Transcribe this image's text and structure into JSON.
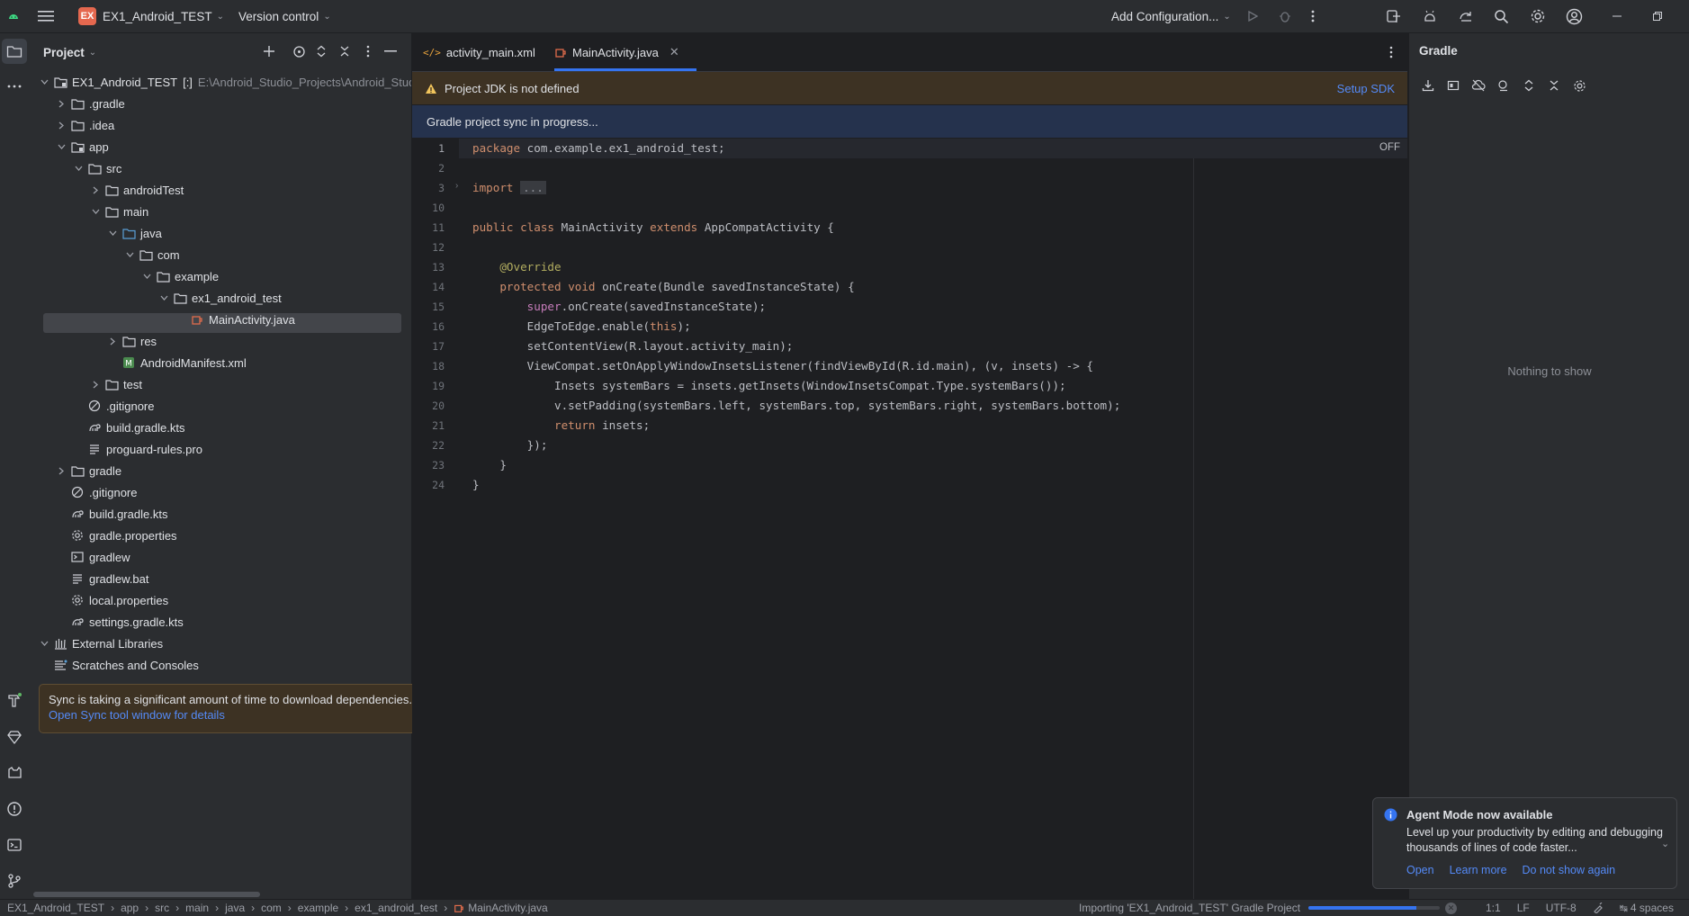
{
  "titlebar": {
    "project_badge": "EX",
    "project_name": "EX1_Android_TEST",
    "vcs": "Version control",
    "run_config": "Add Configuration..."
  },
  "project_panel": {
    "title": "Project",
    "tree": [
      {
        "label": "EX1_Android_TEST",
        "suffix": "[:]",
        "path": "E:\\Android_Studio_Projects\\Android_Stud",
        "icon": "module-folder-icon",
        "expanded": true
      },
      {
        "label": ".gradle",
        "icon": "folder-icon",
        "expanded": false
      },
      {
        "label": ".idea",
        "icon": "folder-icon",
        "expanded": false
      },
      {
        "label": "app",
        "icon": "module-folder-icon",
        "expanded": true
      },
      {
        "label": "src",
        "icon": "folder-icon",
        "expanded": true
      },
      {
        "label": "androidTest",
        "icon": "folder-icon",
        "expanded": false
      },
      {
        "label": "main",
        "icon": "folder-icon",
        "expanded": true
      },
      {
        "label": "java",
        "icon": "source-folder-icon",
        "expanded": true
      },
      {
        "label": "com",
        "icon": "package-folder-icon",
        "expanded": true
      },
      {
        "label": "example",
        "icon": "package-folder-icon",
        "expanded": true
      },
      {
        "label": "ex1_android_test",
        "icon": "package-folder-icon",
        "expanded": true
      },
      {
        "label": "MainActivity.java",
        "icon": "java-file-icon",
        "selected": true
      },
      {
        "label": "res",
        "icon": "resource-folder-icon",
        "expanded": false
      },
      {
        "label": "AndroidManifest.xml",
        "icon": "manifest-file-icon"
      },
      {
        "label": "test",
        "icon": "folder-icon",
        "expanded": false
      },
      {
        "label": ".gitignore",
        "icon": "ignore-file-icon"
      },
      {
        "label": "build.gradle.kts",
        "icon": "gradle-file-icon"
      },
      {
        "label": "proguard-rules.pro",
        "icon": "text-file-icon"
      },
      {
        "label": "gradle",
        "icon": "folder-icon",
        "expanded": false
      },
      {
        "label": ".gitignore",
        "icon": "ignore-file-icon"
      },
      {
        "label": "build.gradle.kts",
        "icon": "gradle-file-icon"
      },
      {
        "label": "gradle.properties",
        "icon": "settings-file-icon"
      },
      {
        "label": "gradlew",
        "icon": "terminal-file-icon"
      },
      {
        "label": "gradlew.bat",
        "icon": "text-file-icon"
      },
      {
        "label": "local.properties",
        "icon": "settings-file-icon"
      },
      {
        "label": "settings.gradle.kts",
        "icon": "gradle-file-icon"
      },
      {
        "label": "External Libraries",
        "icon": "library-icon",
        "expanded": true
      },
      {
        "label": "Scratches and Consoles",
        "icon": "scratches-icon"
      }
    ]
  },
  "sync_tooltip": {
    "message": "Sync is taking a significant amount of time to download dependencies.",
    "link": "Open Sync tool window for details"
  },
  "editor": {
    "tabs": [
      {
        "label": "activity_main.xml",
        "icon": "xml-file-icon",
        "active": false
      },
      {
        "label": "MainActivity.java",
        "icon": "java-file-icon",
        "active": true
      }
    ],
    "jdk_banner": {
      "message": "Project JDK is not defined",
      "action": "Setup SDK"
    },
    "sync_banner": "Gradle project sync in progress...",
    "inlay_off": "OFF",
    "lines": [
      {
        "n": "1",
        "text": "package com.example.ex1_android_test;"
      },
      {
        "n": "2",
        "text": ""
      },
      {
        "n": "3",
        "text": "import ..."
      },
      {
        "n": "10",
        "text": ""
      },
      {
        "n": "11",
        "text": "public class MainActivity extends AppCompatActivity {"
      },
      {
        "n": "12",
        "text": ""
      },
      {
        "n": "13",
        "text": "    @Override"
      },
      {
        "n": "14",
        "text": "    protected void onCreate(Bundle savedInstanceState) {"
      },
      {
        "n": "15",
        "text": "        super.onCreate(savedInstanceState);"
      },
      {
        "n": "16",
        "text": "        EdgeToEdge.enable(this);"
      },
      {
        "n": "17",
        "text": "        setContentView(R.layout.activity_main);"
      },
      {
        "n": "18",
        "text": "        ViewCompat.setOnApplyWindowInsetsListener(findViewById(R.id.main), (v, insets) -> {"
      },
      {
        "n": "19",
        "text": "            Insets systemBars = insets.getInsets(WindowInsetsCompat.Type.systemBars());"
      },
      {
        "n": "20",
        "text": "            v.setPadding(systemBars.left, systemBars.top, systemBars.right, systemBars.bottom);"
      },
      {
        "n": "21",
        "text": "            return insets;"
      },
      {
        "n": "22",
        "text": "        });"
      },
      {
        "n": "23",
        "text": "    }"
      },
      {
        "n": "24",
        "text": "}"
      }
    ]
  },
  "gradle_panel": {
    "title": "Gradle",
    "empty": "Nothing to show"
  },
  "notification": {
    "title": "Agent Mode now available",
    "body": "Level up your productivity by editing and debugging thousands of lines of code faster...",
    "actions": [
      "Open",
      "Learn more",
      "Do not show again"
    ]
  },
  "statusbar": {
    "breadcrumbs": [
      "EX1_Android_TEST",
      "app",
      "src",
      "main",
      "java",
      "com",
      "example",
      "ex1_android_test",
      "MainActivity.java"
    ],
    "task": "Importing 'EX1_Android_TEST' Gradle Project",
    "progress": 0.82,
    "position": "1:1",
    "line_sep": "LF",
    "encoding": "UTF-8",
    "indent": "4 spaces"
  },
  "colors": {
    "accent": "#3574f0",
    "warning_banner": "#3d3223",
    "info_banner": "#25324d",
    "link": "#548af7"
  }
}
